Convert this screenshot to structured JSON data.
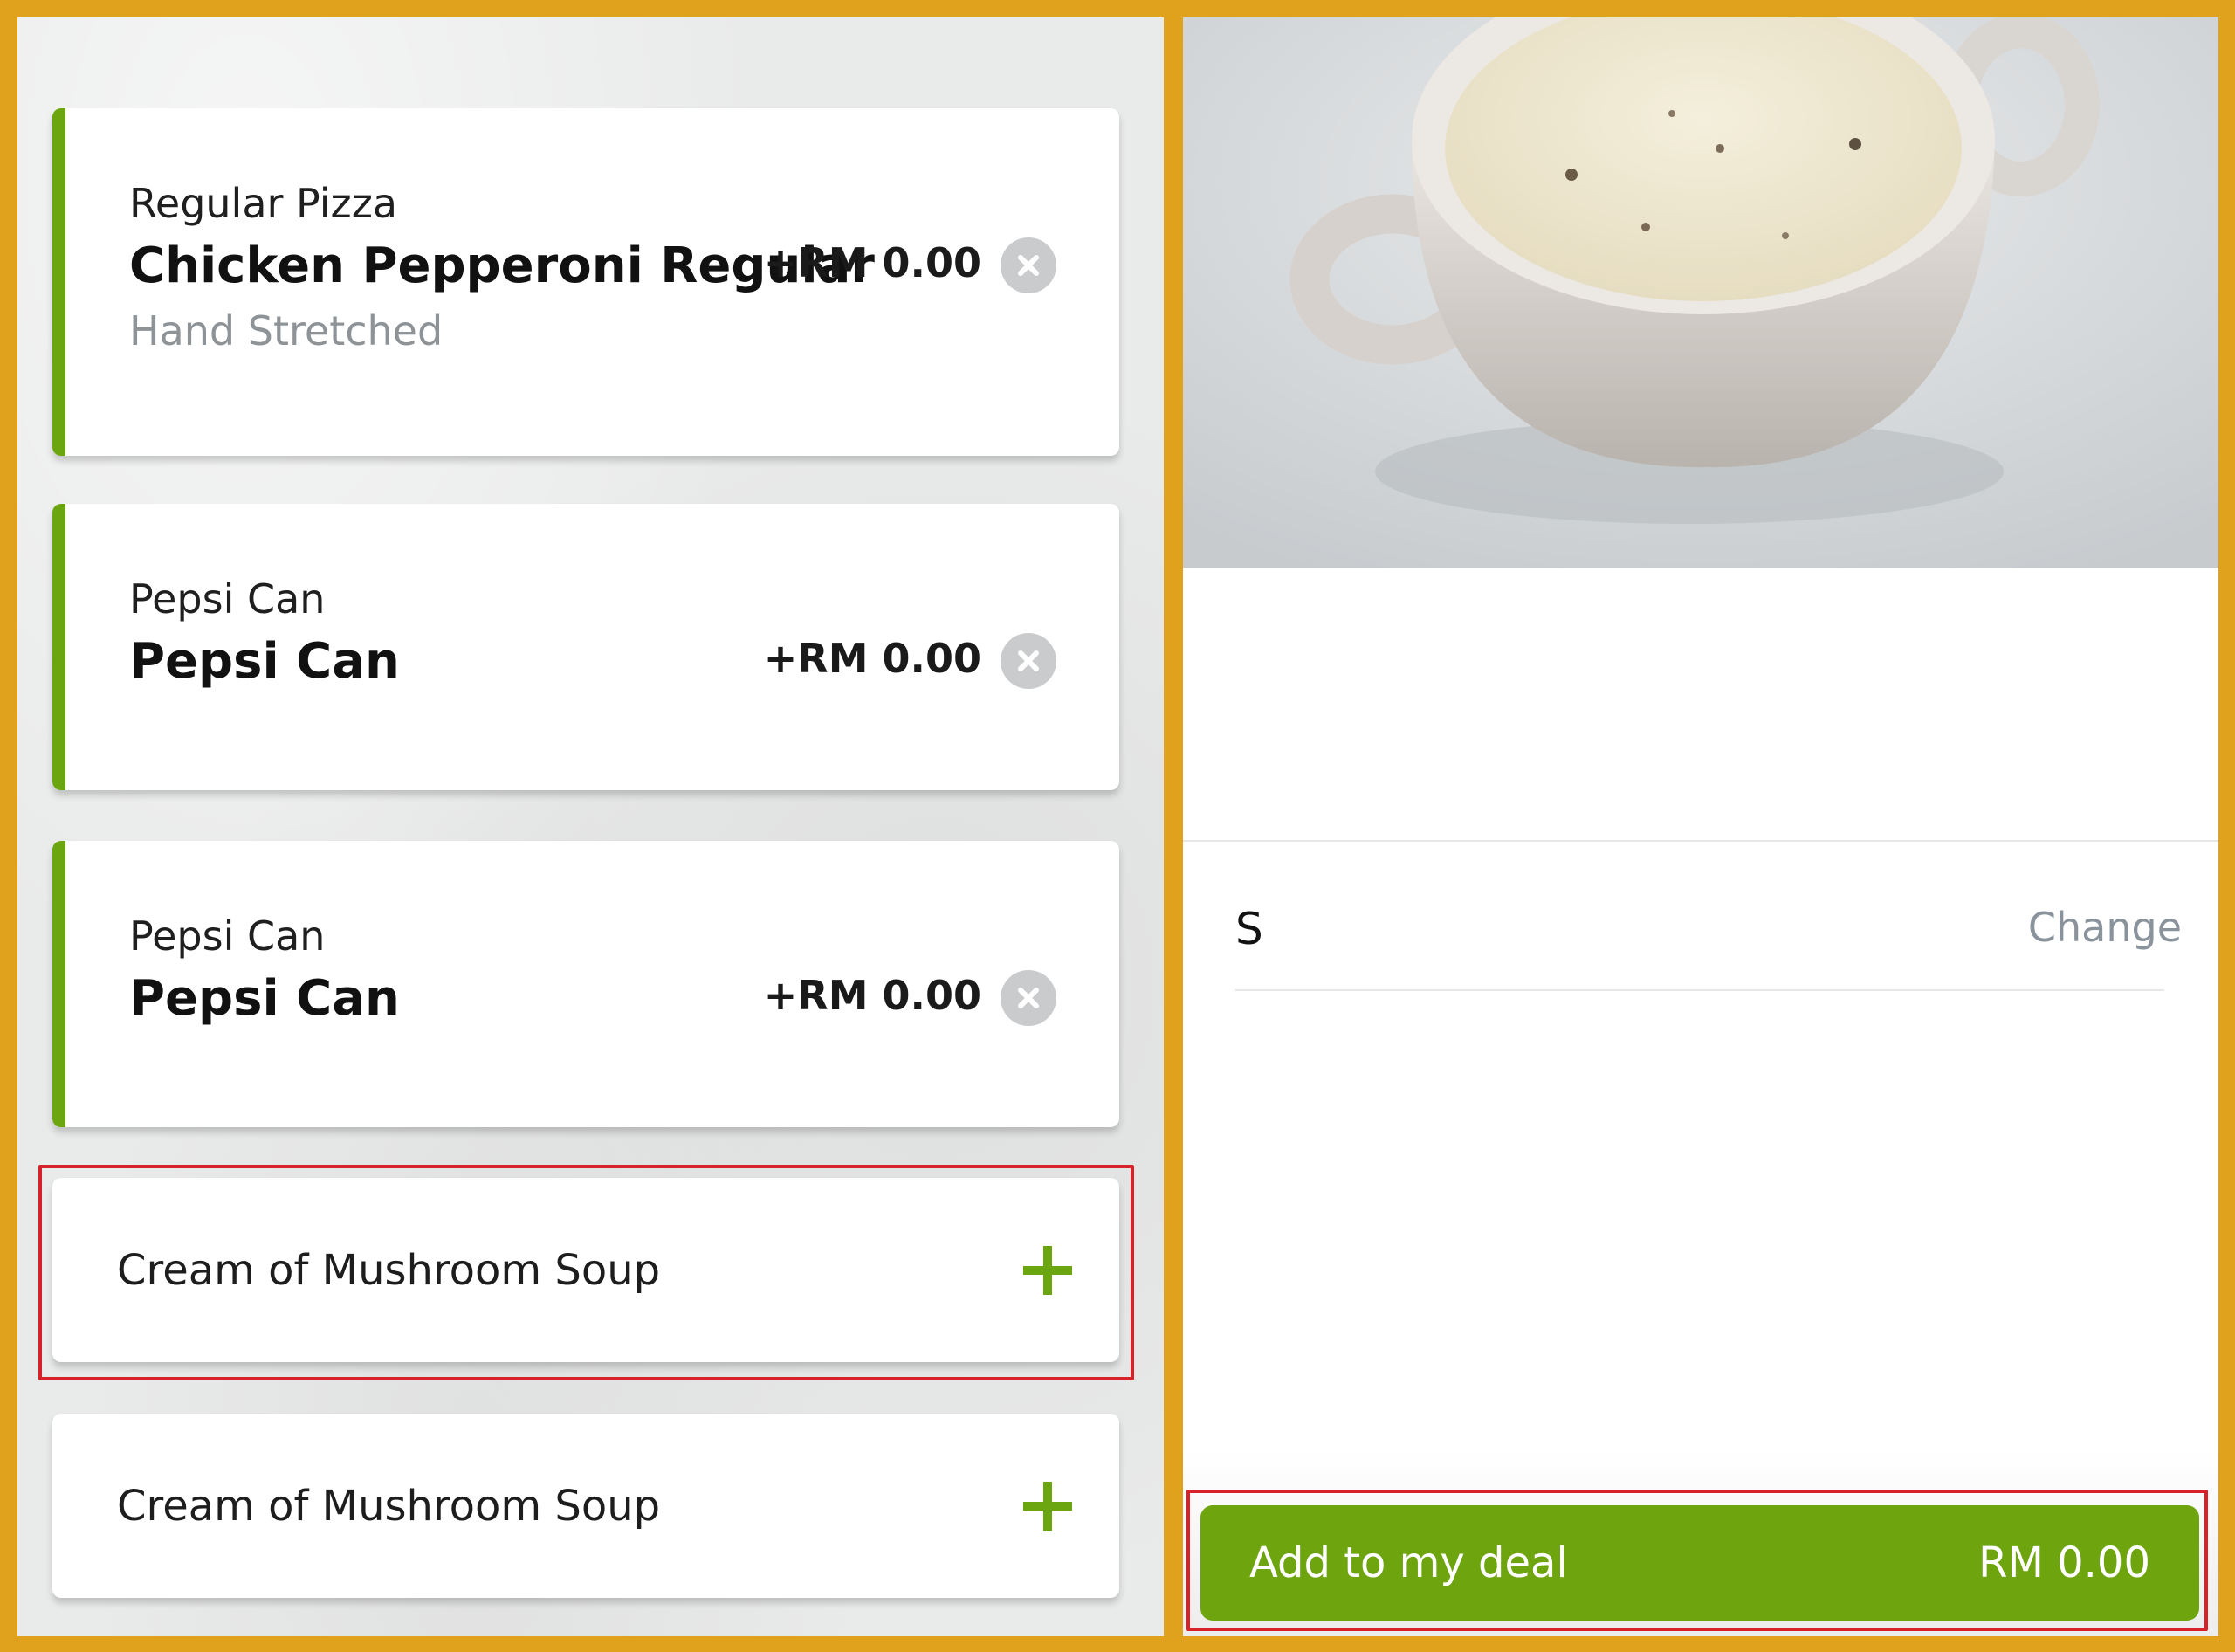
{
  "selected_items": [
    {
      "category": "Regular Pizza",
      "name": "Chicken Pepperoni Regular",
      "option": "Hand Stretched",
      "price": "+RM 0.00"
    },
    {
      "category": "Pepsi Can",
      "name": "Pepsi Can",
      "price": "+RM 0.00"
    },
    {
      "category": "Pepsi Can",
      "name": "Pepsi Can",
      "price": "+RM 0.00"
    }
  ],
  "add_options": [
    {
      "label": "Cream of Mushroom Soup"
    },
    {
      "label": "Cream of Mushroom Soup"
    }
  ],
  "detail": {
    "size_value": "S",
    "change_label": "Change"
  },
  "add_button": {
    "label": "Add to my deal",
    "price": "RM 0.00"
  },
  "colors": {
    "frame": "#e0a11c",
    "accent_green": "#6ea50f",
    "highlight_red": "#d8222a"
  },
  "icons": [
    "close-circle-icon",
    "plus-icon"
  ]
}
